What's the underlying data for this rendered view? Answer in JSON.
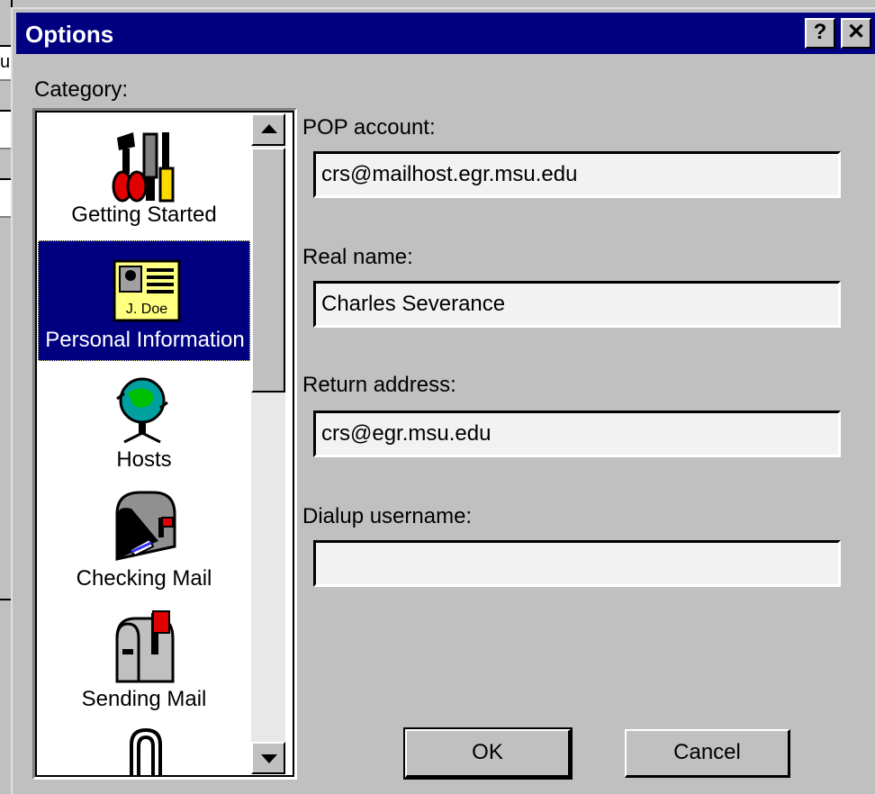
{
  "background_window": {
    "fragment_text": "u"
  },
  "dialog": {
    "title": "Options",
    "help_label": "?",
    "close_label": "✕"
  },
  "category": {
    "label": "Category:",
    "items": [
      {
        "label": "Getting Started",
        "icon": "tools-icon",
        "selected": false
      },
      {
        "label": "Personal Information",
        "icon": "id-card-icon",
        "selected": true
      },
      {
        "label": "Hosts",
        "icon": "globe-icon",
        "selected": false
      },
      {
        "label": "Checking Mail",
        "icon": "mailbox-icon",
        "selected": false
      },
      {
        "label": "Sending Mail",
        "icon": "mailbox-flag-icon",
        "selected": false
      },
      {
        "label": "",
        "icon": "archway-icon",
        "selected": false
      }
    ],
    "id_card_text": "J. Doe"
  },
  "form": {
    "pop_account": {
      "label": "POP account:",
      "value": "crs@mailhost.egr.msu.edu"
    },
    "real_name": {
      "label": "Real name:",
      "value": "Charles Severance"
    },
    "return_address": {
      "label": "Return address:",
      "value": "crs@egr.msu.edu"
    },
    "dialup_username": {
      "label": "Dialup username:",
      "value": ""
    }
  },
  "buttons": {
    "ok": "OK",
    "cancel": "Cancel"
  },
  "colors": {
    "title_bar": "#000080",
    "selection": "#000080",
    "face": "#c0c0c0"
  }
}
